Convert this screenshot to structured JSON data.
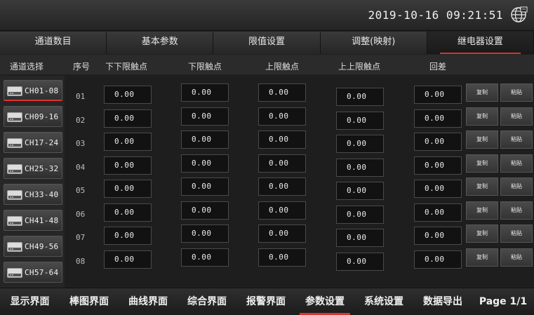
{
  "status": {
    "datetime": "2019-10-16  09:21:51",
    "icon": "globe-network-icon"
  },
  "tabs": [
    {
      "label": "通道数目",
      "active": false
    },
    {
      "label": "基本参数",
      "active": false
    },
    {
      "label": "限值设置",
      "active": false
    },
    {
      "label": "调整(映射)",
      "active": false
    },
    {
      "label": "继电器设置",
      "active": true
    }
  ],
  "columns": {
    "channel_select": "通道选择",
    "seq": "序号",
    "lower_lower": "下下限触点",
    "lower": "下限触点",
    "upper": "上限触点",
    "upper_upper": "上上限触点",
    "hysteresis": "回差"
  },
  "channel_groups": [
    {
      "label": "CH01-08",
      "active": true
    },
    {
      "label": "CH09-16",
      "active": false
    },
    {
      "label": "CH17-24",
      "active": false
    },
    {
      "label": "CH25-32",
      "active": false
    },
    {
      "label": "CH33-40",
      "active": false
    },
    {
      "label": "CH41-48",
      "active": false
    },
    {
      "label": "CH49-56",
      "active": false
    },
    {
      "label": "CH57-64",
      "active": false
    }
  ],
  "rows": [
    {
      "seq": "01",
      "lower_lower": "0.00",
      "lower": "0.00",
      "upper": "0.00",
      "upper_upper": "0.00",
      "hysteresis": "0.00"
    },
    {
      "seq": "02",
      "lower_lower": "0.00",
      "lower": "0.00",
      "upper": "0.00",
      "upper_upper": "0.00",
      "hysteresis": "0.00"
    },
    {
      "seq": "03",
      "lower_lower": "0.00",
      "lower": "0.00",
      "upper": "0.00",
      "upper_upper": "0.00",
      "hysteresis": "0.00"
    },
    {
      "seq": "04",
      "lower_lower": "0.00",
      "lower": "0.00",
      "upper": "0.00",
      "upper_upper": "0.00",
      "hysteresis": "0.00"
    },
    {
      "seq": "05",
      "lower_lower": "0.00",
      "lower": "0.00",
      "upper": "0.00",
      "upper_upper": "0.00",
      "hysteresis": "0.00"
    },
    {
      "seq": "06",
      "lower_lower": "0.00",
      "lower": "0.00",
      "upper": "0.00",
      "upper_upper": "0.00",
      "hysteresis": "0.00"
    },
    {
      "seq": "07",
      "lower_lower": "0.00",
      "lower": "0.00",
      "upper": "0.00",
      "upper_upper": "0.00",
      "hysteresis": "0.00"
    },
    {
      "seq": "08",
      "lower_lower": "0.00",
      "lower": "0.00",
      "upper": "0.00",
      "upper_upper": "0.00",
      "hysteresis": "0.00"
    }
  ],
  "row_actions": {
    "copy": "复制",
    "paste": "粘贴"
  },
  "bottom_nav": [
    {
      "label": "显示界面",
      "active": false
    },
    {
      "label": "棒图界面",
      "active": false
    },
    {
      "label": "曲线界面",
      "active": false
    },
    {
      "label": "综合界面",
      "active": false
    },
    {
      "label": "报警界面",
      "active": false
    },
    {
      "label": "参数设置",
      "active": true
    },
    {
      "label": "系统设置",
      "active": false
    },
    {
      "label": "数据导出",
      "active": false
    },
    {
      "label": "Page 1/1",
      "active": false
    }
  ],
  "colors": {
    "accent": "#dd3333",
    "background": "#1f1f1f",
    "field": "#121212"
  }
}
